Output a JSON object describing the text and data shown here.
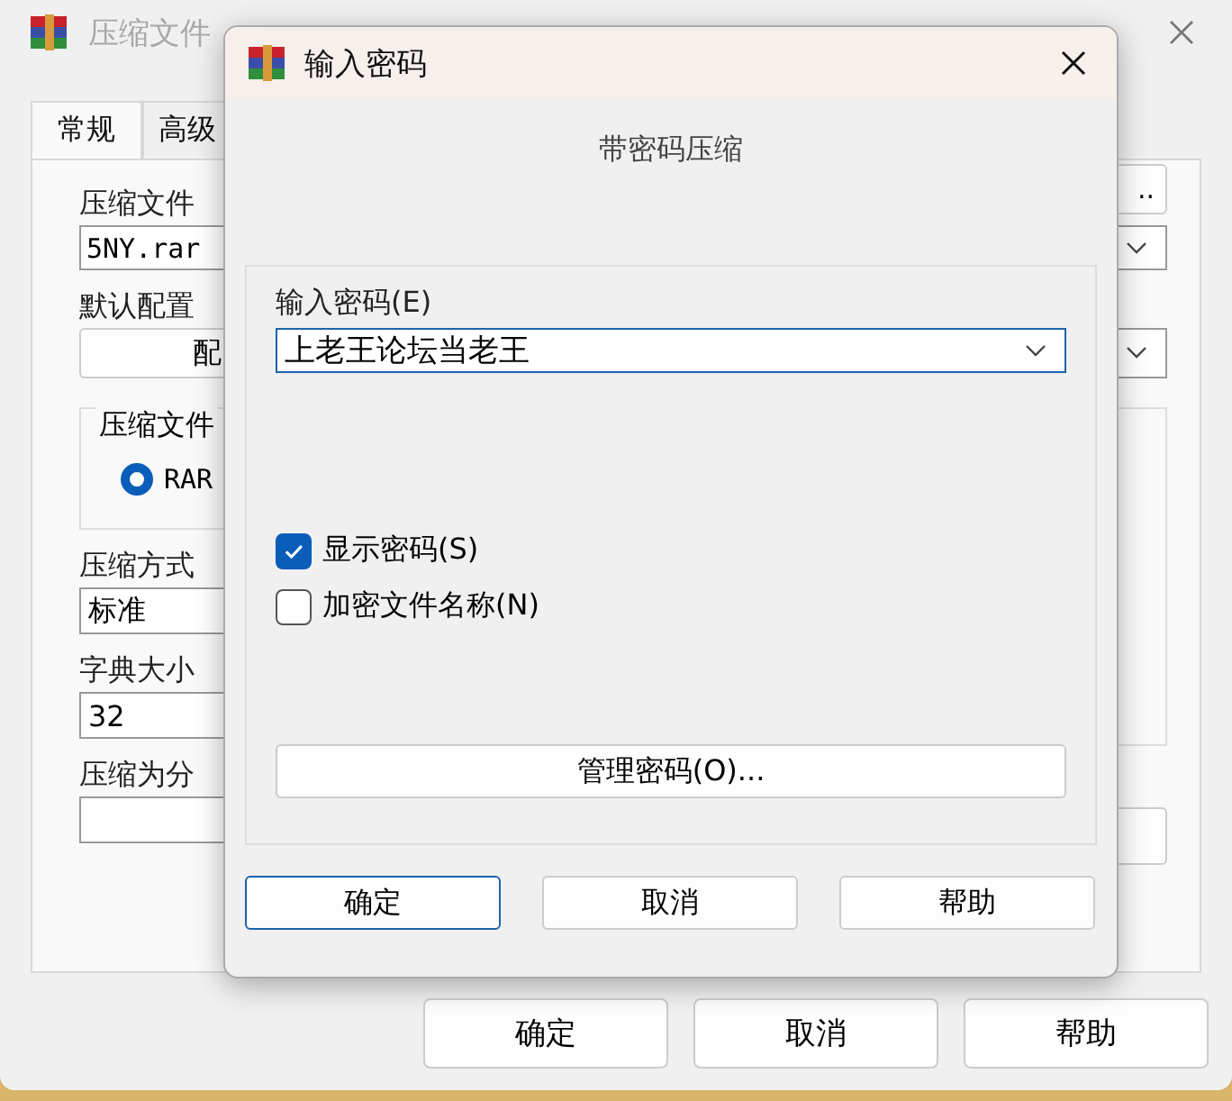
{
  "main_window": {
    "title": "压缩文件",
    "tabs": [
      {
        "label": "常规",
        "selected": true
      },
      {
        "label": "高级",
        "selected": false
      }
    ],
    "archive_name": {
      "label": "压缩文件",
      "value": "5NY.rar"
    },
    "browse_button": "..",
    "profiles": {
      "label": "默认配置",
      "button": "配"
    },
    "format_group": {
      "label": "压缩文件",
      "options": [
        {
          "label": "RAR",
          "selected": true
        }
      ]
    },
    "method": {
      "label": "压缩方式",
      "value": "标准"
    },
    "dictionary": {
      "label": "字典大小",
      "value": "32"
    },
    "volumes": {
      "label": "压缩为分"
    },
    "buttons": [
      "确定",
      "取消",
      "帮助"
    ]
  },
  "dialog": {
    "title": "输入密码",
    "caption": "带密码压缩",
    "password": {
      "label": "输入密码(E)",
      "value": "上老王论坛当老王"
    },
    "options": [
      {
        "label": "显示密码(S)",
        "checked": true
      },
      {
        "label": "加密文件名称(N)",
        "checked": false
      }
    ],
    "manage_button": "管理密码(O)...",
    "buttons": [
      {
        "label": "确定",
        "default": true
      },
      {
        "label": "取消",
        "default": false
      },
      {
        "label": "帮助",
        "default": false
      }
    ]
  }
}
